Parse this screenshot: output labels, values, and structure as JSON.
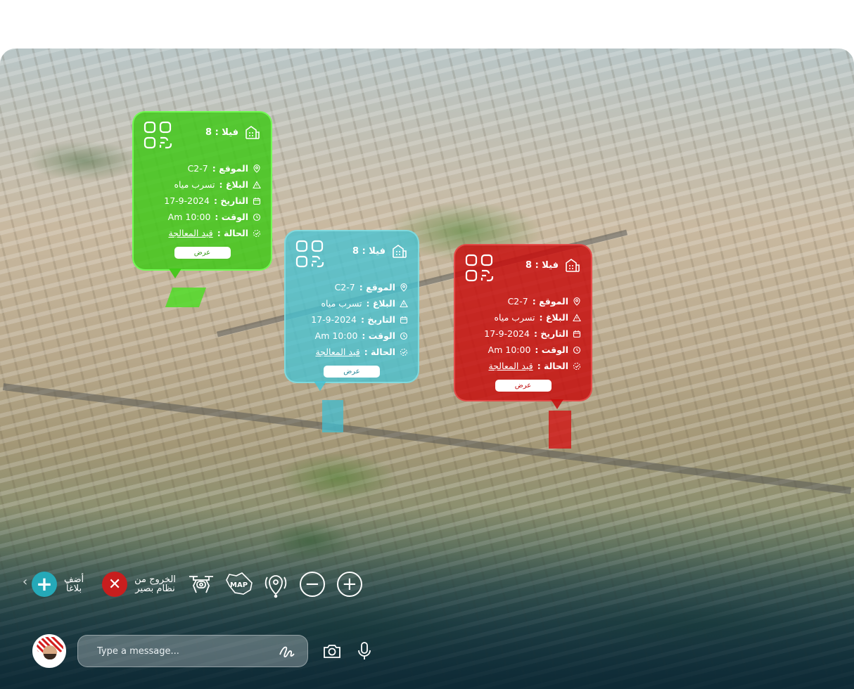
{
  "cards": [
    {
      "color": "green",
      "villa_label": "فيلا : 8",
      "rows": [
        {
          "key": "الموقع :",
          "value": "C2-7",
          "icon": "location-pin-icon"
        },
        {
          "key": "البلاغ :",
          "value": "تسرب مياه",
          "icon": "warning-icon"
        },
        {
          "key": "التاريخ :",
          "value": "17-9-2024",
          "icon": "calendar-icon"
        },
        {
          "key": "الوقت :",
          "value": "Am 10:00",
          "icon": "clock-icon"
        },
        {
          "key": "الحالة :",
          "value": "قيد المعالجة",
          "icon": "status-icon"
        }
      ],
      "button": "عرض"
    },
    {
      "color": "cyan",
      "villa_label": "فيلا : 8",
      "rows": [
        {
          "key": "الموقع :",
          "value": "C2-7",
          "icon": "location-pin-icon"
        },
        {
          "key": "البلاغ :",
          "value": "تسرب مياه",
          "icon": "warning-icon"
        },
        {
          "key": "التاريخ :",
          "value": "17-9-2024",
          "icon": "calendar-icon"
        },
        {
          "key": "الوقت :",
          "value": "Am 10:00",
          "icon": "clock-icon"
        },
        {
          "key": "الحالة :",
          "value": "قيد المعالجة",
          "icon": "status-icon"
        }
      ],
      "button": "عرض"
    },
    {
      "color": "red",
      "villa_label": "فيلا : 8",
      "rows": [
        {
          "key": "الموقع :",
          "value": "C2-7",
          "icon": "location-pin-icon"
        },
        {
          "key": "البلاغ :",
          "value": "تسرب مياه",
          "icon": "warning-icon"
        },
        {
          "key": "التاريخ :",
          "value": "17-9-2024",
          "icon": "calendar-icon"
        },
        {
          "key": "الوقت :",
          "value": "Am 10:00",
          "icon": "clock-icon"
        },
        {
          "key": "الحالة :",
          "value": "قيد المعالجة",
          "icon": "status-icon"
        }
      ],
      "button": "عرض"
    }
  ],
  "toolbar": {
    "add_report_line1": "أضف",
    "add_report_line2": "بلاغاً",
    "exit_line1": "الخروج من",
    "exit_line2": "نظام بصير",
    "map_icon_text": "MAP"
  },
  "composer": {
    "placeholder": "Type a message..."
  },
  "colors": {
    "green": "#3cc814",
    "cyan": "#46c3d2",
    "red": "#c80a0a",
    "add_button": "#25a9b8",
    "exit_button": "#c81e1e"
  }
}
